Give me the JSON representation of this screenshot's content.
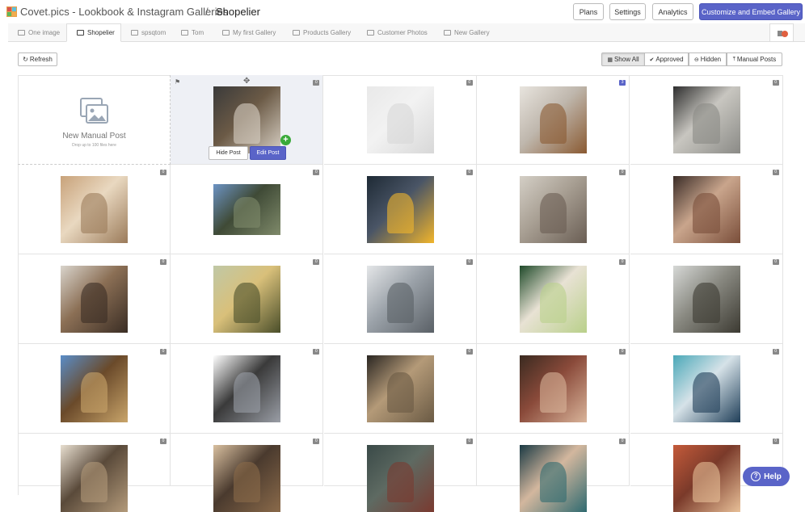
{
  "header": {
    "app_title": "Covet.pics - Lookbook & Instagram Galleries",
    "separator": "/",
    "page_title": "Shopelier",
    "buttons": {
      "plans": "Plans",
      "settings": "Settings",
      "analytics": "Analytics",
      "customize": "Customize and Embed Gallery"
    }
  },
  "tabs": [
    {
      "label": "One image",
      "icon": "image-icon"
    },
    {
      "label": "Shopelier",
      "icon": "image-icon",
      "active": true
    },
    {
      "label": "spsqtom",
      "icon": "image-icon"
    },
    {
      "label": "Tom",
      "icon": "image-icon"
    },
    {
      "label": "My first Gallery",
      "icon": "image-icon"
    },
    {
      "label": "Products Gallery",
      "icon": "product-icon"
    },
    {
      "label": "Customer Photos",
      "icon": "customer-icon"
    },
    {
      "label": "New Gallery",
      "icon": "gallery-icon"
    }
  ],
  "toolbar": {
    "refresh": "Refresh",
    "filters": {
      "show_all": "Show All",
      "approved": "Approved",
      "hidden": "Hidden",
      "manual_posts": "Manual Posts"
    }
  },
  "manual_post": {
    "title": "New Manual Post",
    "subtitle": "Drop up to 100 files here"
  },
  "hover_actions": {
    "hide": "Hide Post",
    "edit": "Edit Post"
  },
  "posts": [
    {
      "badge": "0",
      "desc": "cafe interior"
    },
    {
      "badge": "0",
      "desc": "man with dog (faded)"
    },
    {
      "badge": "3",
      "desc": "boot on shelf"
    },
    {
      "badge": "0",
      "desc": "man looking back"
    },
    {
      "badge": "0",
      "desc": "bedroom"
    },
    {
      "badge": "0",
      "desc": "mountain valley"
    },
    {
      "badge": "0",
      "desc": "yellow coat"
    },
    {
      "badge": "0",
      "desc": "armchair"
    },
    {
      "badge": "0",
      "desc": "man with dog"
    },
    {
      "badge": "0",
      "desc": "wardrobe display"
    },
    {
      "badge": "0",
      "desc": "lake feet"
    },
    {
      "badge": "0",
      "desc": "woman by water"
    },
    {
      "badge": "0",
      "desc": "dress walking"
    },
    {
      "badge": "0",
      "desc": "snowy forest"
    },
    {
      "badge": "0",
      "desc": "boot step"
    },
    {
      "badge": "0",
      "desc": "woman on pier"
    },
    {
      "badge": "0",
      "desc": "boots on rock"
    },
    {
      "badge": "0",
      "desc": "woman with hat"
    },
    {
      "badge": "0",
      "desc": "lake hiker"
    },
    {
      "badge": "0",
      "desc": "gift box"
    },
    {
      "badge": "0",
      "desc": "guitar player"
    },
    {
      "badge": "0",
      "desc": "red sweater"
    },
    {
      "badge": "0",
      "desc": "woman in leaves"
    },
    {
      "badge": "0",
      "desc": "sunset girl"
    }
  ],
  "help": {
    "label": "Help"
  },
  "colors": {
    "accent": "#5a64c8"
  }
}
